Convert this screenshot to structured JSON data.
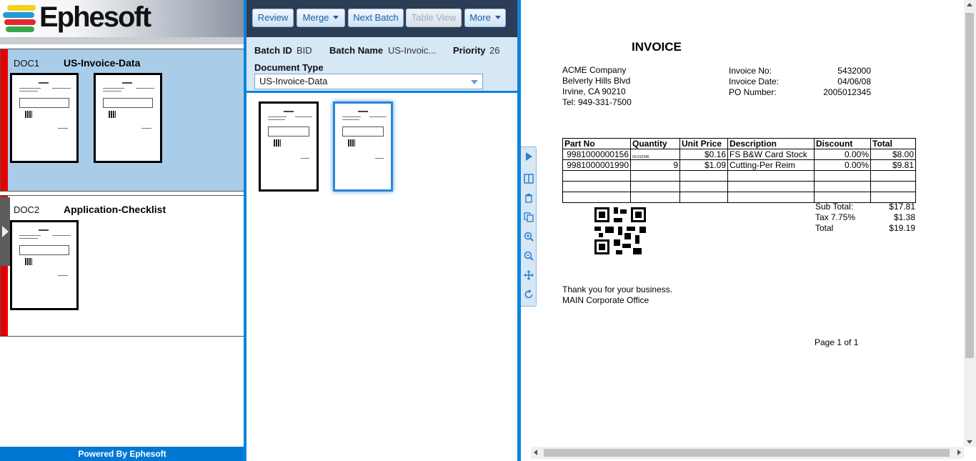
{
  "brand": {
    "name": "Ephesoft",
    "footer": "Powered By Ephesoft"
  },
  "documents": [
    {
      "id": "DOC1",
      "title": "US-Invoice-Data",
      "pages": 2
    },
    {
      "id": "DOC2",
      "title": "Application-Checklist",
      "pages": 1
    }
  ],
  "toolbar": {
    "review": "Review",
    "merge": "Merge",
    "next_batch": "Next Batch",
    "table_view": "Table View",
    "more": "More"
  },
  "batch": {
    "batch_id_label": "Batch ID",
    "batch_id": "BID",
    "batch_name_label": "Batch Name",
    "batch_name": "US-Invoic...",
    "priority_label": "Priority",
    "priority": "26",
    "doc_type_label": "Document Type",
    "doc_type": "US-Invoice-Data"
  },
  "invoice": {
    "title": "INVOICE",
    "company": [
      "ACME Company",
      "Belverly Hills Blvd",
      "Irvine, CA 90210",
      "Tel: 949-331-7500"
    ],
    "meta": [
      {
        "label": "Invoice No:",
        "value": "5432000"
      },
      {
        "label": "Invoice Date:",
        "value": "04/06/08"
      },
      {
        "label": "PO Number:",
        "value": "2005012345"
      }
    ],
    "columns": [
      "Part No",
      "Quantity",
      "Unit Price",
      "Description",
      "Discount",
      "Total"
    ],
    "rows": [
      {
        "part": "9981000000156",
        "qty": "50.012345",
        "price": "$0.16",
        "desc": "FS B&W Card Stock",
        "disc": "0.00%",
        "total": "$8.00"
      },
      {
        "part": "9981000001990",
        "qty": "9",
        "price": "$1.09",
        "desc": "Cutting-Per Reim",
        "disc": "0.00%",
        "total": "$9.81"
      }
    ],
    "totals": [
      {
        "label": "Sub Total:",
        "value": "$17.81"
      },
      {
        "label": "Tax 7.75%",
        "value": "$1.38"
      },
      {
        "label": "Total",
        "value": "$19.19"
      }
    ],
    "thanks": "Thank you for your business.",
    "office": "MAIN Corporate Office",
    "page": "Page 1 of 1"
  },
  "colors": {
    "accent": "#0c84dc",
    "selected_doc": "#a9cde9",
    "error_strip": "#e60000",
    "toolbar_bg": "#2c3e55"
  }
}
